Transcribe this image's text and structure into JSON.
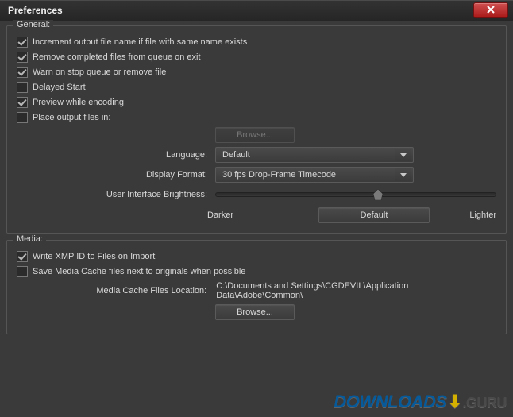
{
  "title": "Preferences",
  "general": {
    "legend": "General:",
    "checks": {
      "increment": {
        "label": "Increment output file name if file with same name exists",
        "checked": true
      },
      "remove_complete": {
        "label": "Remove completed files from queue on exit",
        "checked": true
      },
      "warn_stop": {
        "label": "Warn on stop queue or remove file",
        "checked": true
      },
      "delayed_start": {
        "label": "Delayed Start",
        "checked": false
      },
      "preview": {
        "label": "Preview while encoding",
        "checked": true
      },
      "place_output": {
        "label": "Place output files in:",
        "checked": false
      }
    },
    "browse_disabled_label": "Browse...",
    "language_label": "Language:",
    "language_value": "Default",
    "display_format_label": "Display Format:",
    "display_format_value": "30 fps Drop-Frame Timecode",
    "brightness_label": "User Interface Brightness:",
    "brightness_darker": "Darker",
    "brightness_default_btn": "Default",
    "brightness_lighter": "Lighter"
  },
  "media": {
    "legend": "Media:",
    "checks": {
      "write_xmp": {
        "label": "Write XMP ID to Files on Import",
        "checked": true
      },
      "save_cache": {
        "label": "Save Media Cache files next to originals when possible",
        "checked": false
      }
    },
    "cache_location_label": "Media Cache Files Location:",
    "cache_location_value": "C:\\Documents and Settings\\CGDEVIL\\Application Data\\Adobe\\Common\\",
    "browse_label": "Browse..."
  },
  "watermark": {
    "part1": "DOWNLOADS",
    "part2": ".GURU"
  }
}
